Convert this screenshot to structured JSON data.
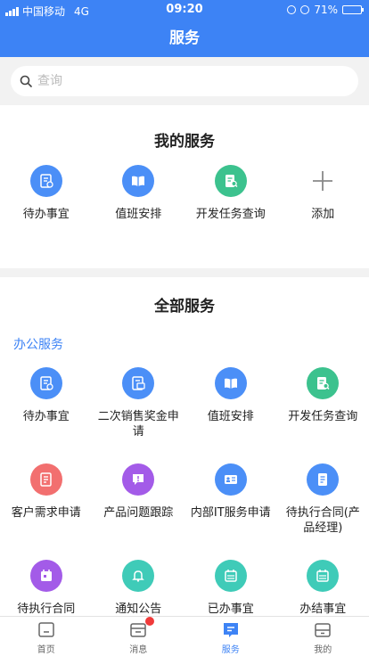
{
  "status_bar": {
    "carrier": "中国移动",
    "network": "4G",
    "time": "09:20",
    "battery": "71%",
    "battery_level": 0.71
  },
  "nav": {
    "title": "服务"
  },
  "search": {
    "placeholder": "查询"
  },
  "my_services": {
    "title": "我的服务",
    "items": [
      {
        "label": "待办事宜",
        "icon": "todo-icon",
        "color": "#4b8ff7"
      },
      {
        "label": "值班安排",
        "icon": "book-icon",
        "color": "#4b8ff7"
      },
      {
        "label": "开发任务查询",
        "icon": "task-search-icon",
        "color": "#3cc28e"
      }
    ],
    "add_label": "添加"
  },
  "all_services": {
    "title": "全部服务",
    "group_label": "办公服务",
    "items": [
      {
        "label": "待办事宜",
        "icon": "todo-icon",
        "color": "#4b8ff7"
      },
      {
        "label": "二次销售奖金申请",
        "icon": "bonus-icon",
        "color": "#4b8ff7"
      },
      {
        "label": "值班安排",
        "icon": "book-icon",
        "color": "#4b8ff7"
      },
      {
        "label": "开发任务查询",
        "icon": "task-search-icon",
        "color": "#3cc28e"
      },
      {
        "label": "客户需求申请",
        "icon": "request-icon",
        "color": "#f26f6f"
      },
      {
        "label": "产品问题跟踪",
        "icon": "issue-icon",
        "color": "#a35be8"
      },
      {
        "label": "内部IT服务申请",
        "icon": "id-card-icon",
        "color": "#4b8ff7"
      },
      {
        "label": "待执行合同(产品经理)",
        "icon": "contract-icon",
        "color": "#4b8ff7"
      },
      {
        "label": "待执行合同",
        "icon": "calendar-icon",
        "color": "#a35be8"
      },
      {
        "label": "通知公告",
        "icon": "bell-icon",
        "color": "#3fcbb8"
      },
      {
        "label": "已办事宜",
        "icon": "calendar-grid-icon",
        "color": "#3fcbb8"
      },
      {
        "label": "办结事宜",
        "icon": "calendar-grid-icon",
        "color": "#3fcbb8"
      }
    ]
  },
  "tabbar": {
    "items": [
      {
        "label": "首页",
        "icon": "home-icon",
        "active": false
      },
      {
        "label": "消息",
        "icon": "message-icon",
        "active": false,
        "badge": true
      },
      {
        "label": "服务",
        "icon": "service-icon",
        "active": true
      },
      {
        "label": "我的",
        "icon": "profile-icon",
        "active": false
      }
    ]
  },
  "colors": {
    "primary": "#3d83f5",
    "badge": "#f03a3a"
  }
}
